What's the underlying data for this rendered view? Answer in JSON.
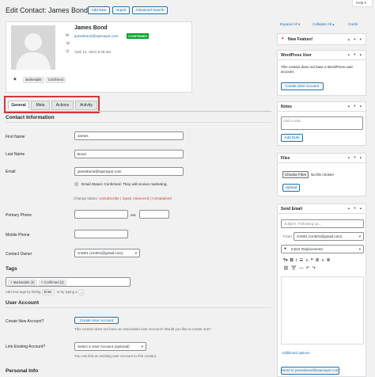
{
  "page": {
    "title": "Edit Contact: James Bond",
    "help": "Help"
  },
  "header_buttons": {
    "add_new": "Add New",
    "import": "Import",
    "advanced_search": "Advanced Search"
  },
  "screen_options": {
    "expand_all": "Expand All",
    "collapse_all": "Collapse All",
    "cards": "Cards"
  },
  "contact": {
    "name": "James Bond",
    "email": "jamesbond@wpmayor.com",
    "status_badge": "CONFIRMED",
    "date": "April 14, 2021 6:35 am",
    "tags": [
      "Marketable",
      "Confirmed"
    ]
  },
  "tabs": [
    "General",
    "Meta",
    "Actions",
    "Activity"
  ],
  "contact_info": {
    "heading": "Contact Information",
    "first_name_label": "First Name",
    "first_name": "James",
    "last_name_label": "Last Name",
    "last_name": "Bond",
    "email_label": "Email",
    "email": "jamesbond@wpmayor.com",
    "email_status": "Email Status: Confirmed. They will receive marketing.",
    "change_status_label": "Change status:",
    "status_unsubscribe": "Unsubscribe",
    "status_spam": "Spam",
    "status_bounced": "Bounced",
    "status_complained": "Complained",
    "primary_phone_label": "Primary Phone",
    "ext_label": "ext.",
    "mobile_phone_label": "Mobile Phone",
    "owner_label": "Contact Owner",
    "owner": "cm001 (cm001@gmail.com)"
  },
  "tags_section": {
    "heading": "Tags",
    "chips": [
      "× Marketable (3)",
      "× Confirmed (3)"
    ],
    "hint_before": "Add new tags by hitting",
    "hint_enter": "Enter",
    "hint_mid": "or by typing a",
    "hint_comma": ","
  },
  "user_account": {
    "heading": "User Account",
    "create_label": "Create New Account?",
    "create_button": "Create User Account",
    "create_help": "This contact does not have an associated user account? Would you like to create one?",
    "link_label": "Link Existing Account?",
    "link_select": "Select a User Account (optional)",
    "link_help": "You can link an existing user account to this contact."
  },
  "personal_info": {
    "heading": "Personal Info"
  },
  "sidebar": {
    "new_feature": "New Feature!",
    "wp_user": {
      "title": "WordPress User",
      "text": "This contact does not have a WordPress user account.",
      "button": "Create User Account"
    },
    "notes": {
      "title": "Notes",
      "placeholder": "Add a note...",
      "button": "Add Note"
    },
    "files": {
      "title": "Files",
      "choose": "Choose Files",
      "no_file": "No file chosen",
      "upload": "Upload"
    },
    "send_email": {
      "title": "Send Email",
      "subject_placeholder": "Subject: Following up...",
      "from_label": "From:",
      "from_value": "cm001 (cm001@gmail.com)",
      "insert_replacement": "Insert Replacement",
      "additional_options": "Additional options",
      "send_button": "Send to jamesbond@wpmayor.com"
    }
  },
  "colors": {
    "accent": "#2271b1",
    "confirmed": "#00a32a",
    "highlight_border": "#d63638",
    "danger": "#d63638"
  }
}
